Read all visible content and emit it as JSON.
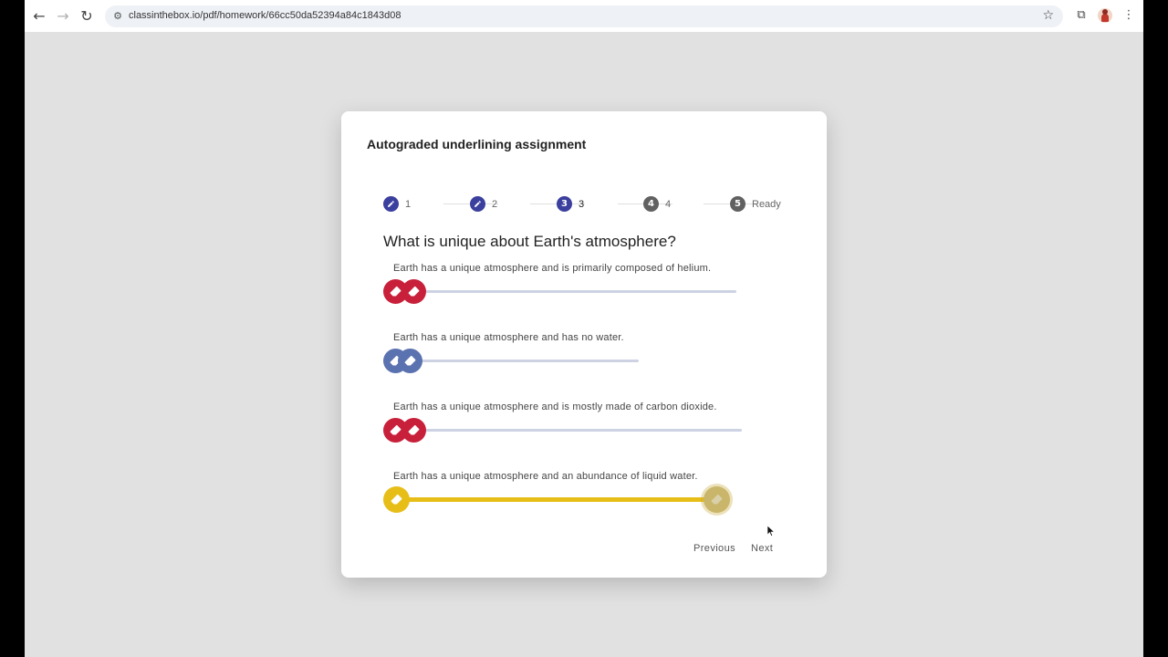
{
  "browser": {
    "url": "classinthebox.io/pdf/homework/66cc50da52394a84c1843d08",
    "icons": {
      "back": "←",
      "forward": "→",
      "reload": "↻",
      "site_info": "⚙",
      "bookmark": "☆",
      "extensions": "⧉",
      "menu": "⋮"
    }
  },
  "assignment": {
    "title": "Autograded underlining assignment",
    "steps": [
      {
        "badge": "",
        "label": "1",
        "state": "done"
      },
      {
        "badge": "",
        "label": "2",
        "state": "done"
      },
      {
        "badge": "3",
        "label": "3",
        "state": "active"
      },
      {
        "badge": "4",
        "label": "4",
        "state": "pending"
      },
      {
        "badge": "5",
        "label": "Ready",
        "state": "pending"
      }
    ],
    "question": "What is unique about Earth's atmosphere?",
    "options": [
      {
        "text": "Earth has a unique atmosphere and is primarily composed of helium.",
        "color": "#c8203a",
        "track_color": "#cdd3e3",
        "selected": false
      },
      {
        "text": "Earth has a unique atmosphere and has no water.",
        "color": "#5b72b0",
        "track_color": "#cdd3e3",
        "selected": false
      },
      {
        "text": "Earth has a unique atmosphere and is mostly made of carbon dioxide.",
        "color": "#c8203a",
        "track_color": "#cdd3e3",
        "selected": false
      },
      {
        "text": "Earth has a unique atmosphere and an abundance of liquid water.",
        "color": "#e7be18",
        "track_color": "#e7be18",
        "selected": true
      }
    ],
    "previous_label": "Previous",
    "next_label": "Next"
  },
  "colors": {
    "step_done": "#3b3f9e",
    "step_active": "#3b3f9e",
    "step_pending": "#616161"
  }
}
